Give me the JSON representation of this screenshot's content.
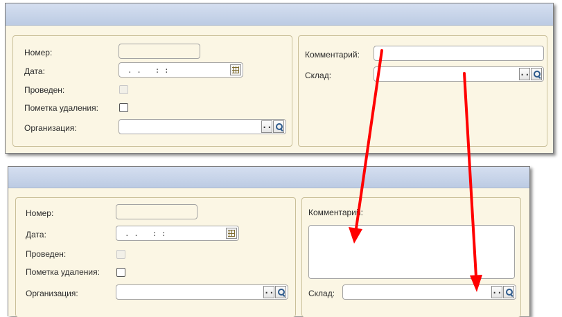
{
  "form_before": {
    "labels": {
      "number": "Номер:",
      "date": "Дата:",
      "posted": "Проведен:",
      "deletion_mark": "Пометка удаления:",
      "organization": "Организация:",
      "comment": "Комментарий:",
      "warehouse": "Склад:"
    },
    "values": {
      "number": "",
      "date": ". .   : :",
      "organization": "",
      "comment": "",
      "warehouse": ""
    },
    "buttons": {
      "select": "...",
      "search": "search-icon",
      "calendar": "calendar-icon"
    }
  },
  "form_after": {
    "labels": {
      "number": "Номер:",
      "date": "Дата:",
      "posted": "Проведен:",
      "deletion_mark": "Пометка удаления:",
      "organization": "Организация:",
      "comment": "Комментарий:",
      "warehouse": "Склад:"
    },
    "values": {
      "number": "",
      "date": ". .   : :",
      "organization": "",
      "comment": "",
      "warehouse": ""
    },
    "buttons": {
      "select": "...",
      "search": "search-icon",
      "calendar": "calendar-icon"
    }
  },
  "colors": {
    "panel_bg": "#fbf6e4",
    "title_bar": "#c6d3e8",
    "group_border": "#c9bf98",
    "arrow": "#ff0000"
  }
}
